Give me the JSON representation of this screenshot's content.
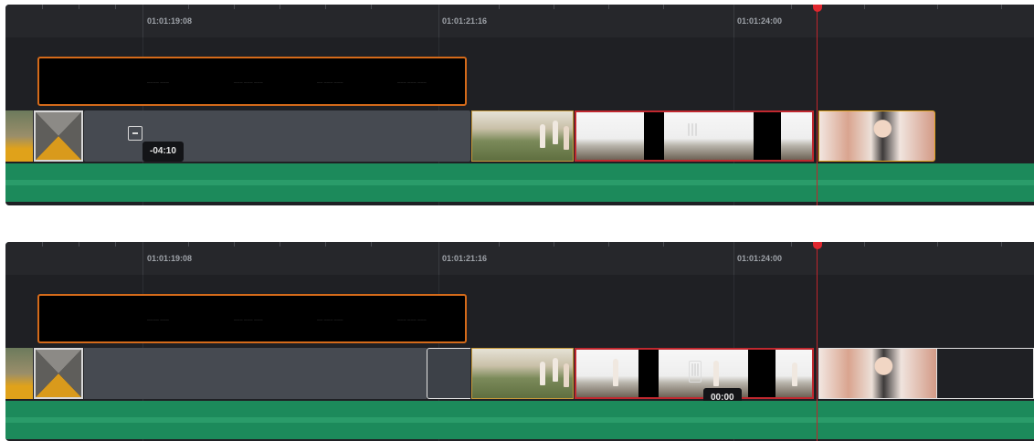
{
  "panels": [
    {
      "ruler": {
        "timecodes": [
          "01:01:19:08",
          "01:01:21:16",
          "01:01:24:00"
        ]
      },
      "tooltip": "-04:10",
      "title_clip": {
        "text_items": [
          "———— ———",
          "——— ——— ———",
          "—— ——— ———",
          "——— ——— ———"
        ]
      }
    },
    {
      "ruler": {
        "timecodes": [
          "01:01:19:08",
          "01:01:21:16",
          "01:01:24:00"
        ]
      },
      "tooltip": "00:00",
      "title_clip": {
        "text_items": [
          "———— ———",
          "——— ——— ———",
          "—— ——— ———",
          "——— ——— ———"
        ]
      }
    }
  ],
  "colors": {
    "panel_bg": "#1f2024",
    "ruler_bg": "#26272b",
    "audio_track": "#1c8a5b",
    "playhead": "#e0282f",
    "selected_clip_border": "#c0282f",
    "title_clip_border": "#d46a1a",
    "clip_border_amber": "#e0a21a"
  },
  "icons": [
    "range-handle-icon",
    "slip-grip-icon",
    "playhead-marker-icon"
  ]
}
